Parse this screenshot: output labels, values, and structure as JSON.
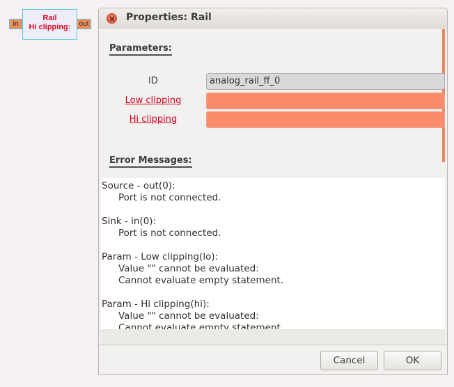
{
  "canvas": {
    "block": {
      "name": "Rail",
      "param_line": "Hi clipping:",
      "in_port": "in",
      "out_port": "out"
    }
  },
  "dialog": {
    "title": "Properties: Rail",
    "parameters_heading": "Parameters:",
    "params": [
      {
        "label": "ID",
        "value": "analog_rail_ff_0"
      },
      {
        "label": "Low clipping",
        "value": ""
      },
      {
        "label": "Hi clipping",
        "value": ""
      }
    ],
    "errors_heading": "Error Messages:",
    "errors": [
      {
        "head": "Source - out(0):",
        "lines": [
          "Port is not connected."
        ]
      },
      {
        "head": "Sink - in(0):",
        "lines": [
          "Port is not connected."
        ]
      },
      {
        "head": "Param - Low clipping(lo):",
        "lines": [
          "Value \"\" cannot be evaluated:",
          "Cannot evaluate empty statement."
        ]
      },
      {
        "head": "Param - Hi clipping(hi):",
        "lines": [
          "Value \"\" cannot be evaluated:",
          "Cannot evaluate empty statement."
        ]
      }
    ],
    "buttons": {
      "cancel": "Cancel",
      "ok": "OK"
    }
  },
  "colors": {
    "error_text": "#d2001a",
    "error_field": "#fb8b6a",
    "port_fill": "#ee8e5d",
    "block_border": "#57c9d4"
  }
}
